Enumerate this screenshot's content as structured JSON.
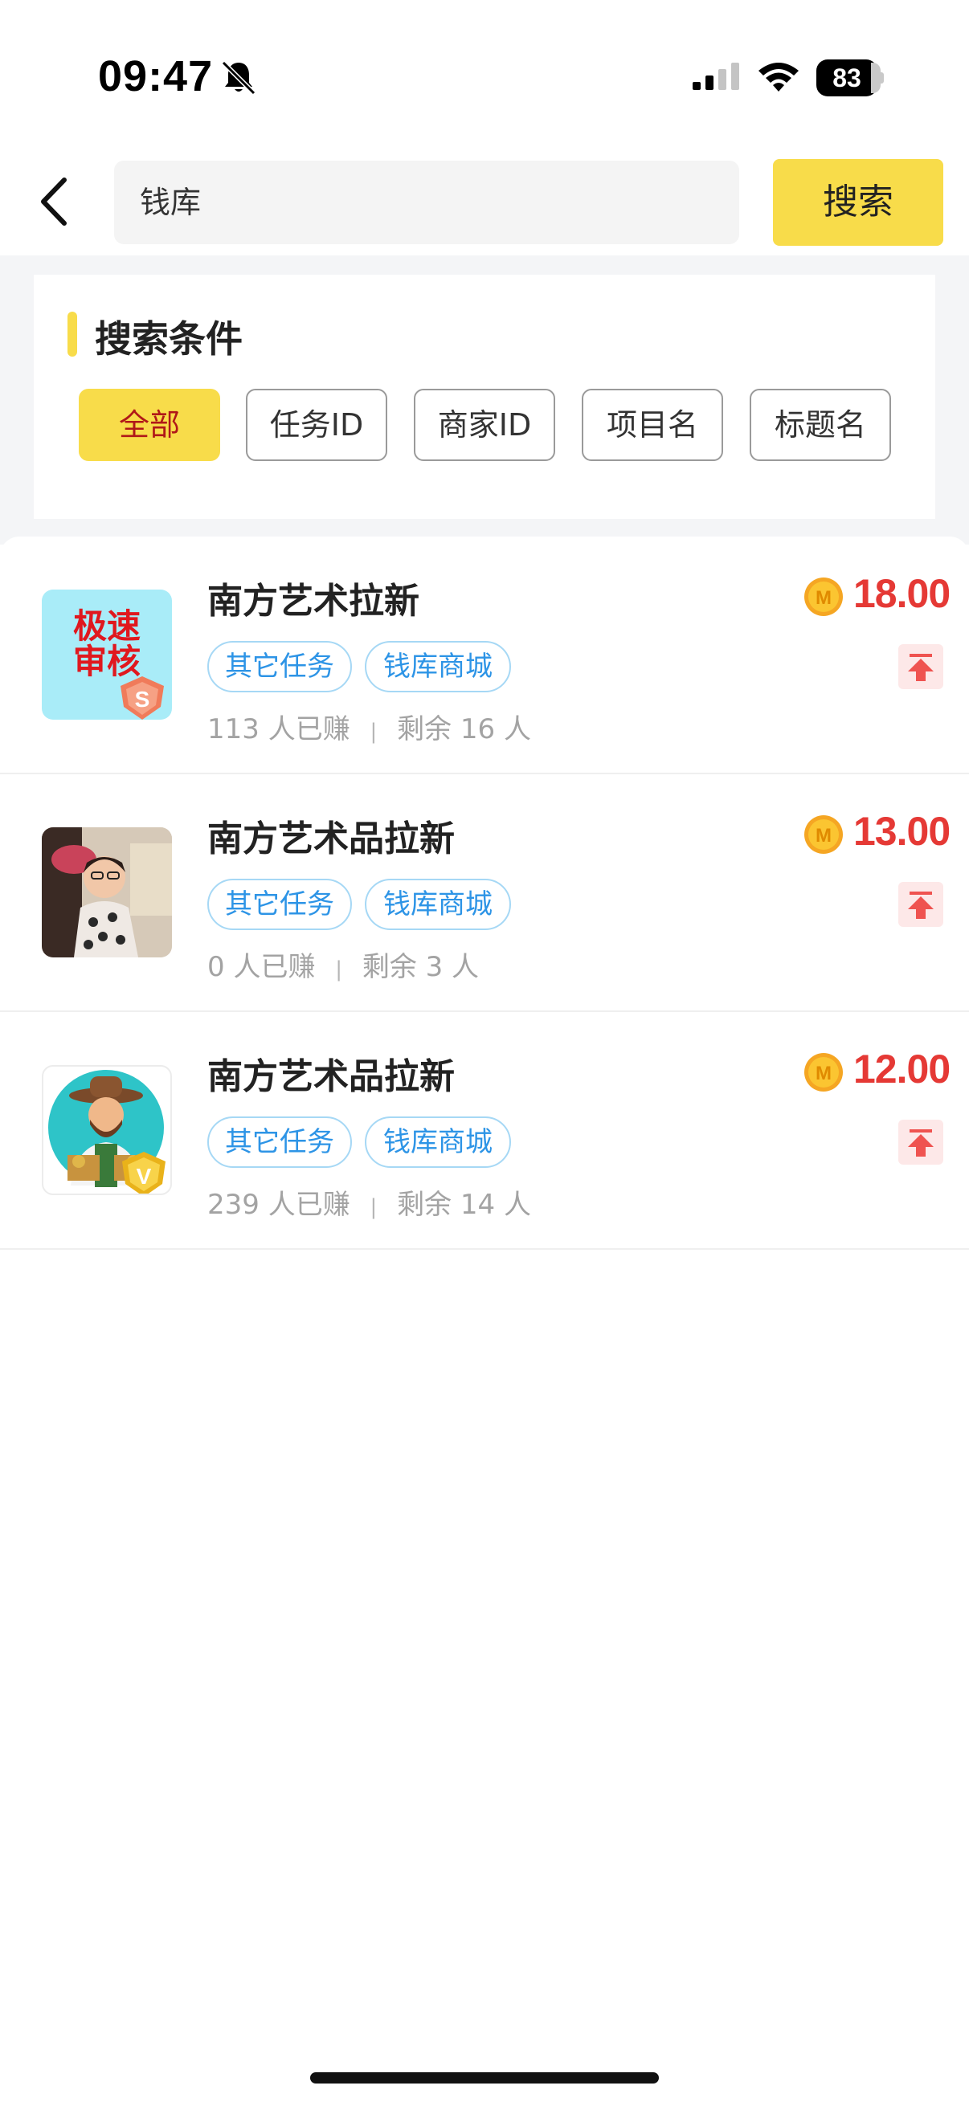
{
  "status_bar": {
    "time": "09:47",
    "battery": "83"
  },
  "search": {
    "value": "钱库",
    "button_label": "搜索"
  },
  "filter": {
    "title": "搜索条件",
    "chips": [
      "全部",
      "任务ID",
      "商家ID",
      "项目名",
      "标题名"
    ],
    "active_index": 0
  },
  "thumb_badges": {
    "first": "极速\n审核",
    "first_badge": "S",
    "third_badge": "V"
  },
  "tasks": [
    {
      "title": "南方艺术拉新",
      "tags": [
        "其它任务",
        "钱库商城"
      ],
      "earned": "113 人已赚",
      "remaining": "剩余 16 人",
      "price": "18.00"
    },
    {
      "title": "南方艺术品拉新",
      "tags": [
        "其它任务",
        "钱库商城"
      ],
      "earned": "0 人已赚",
      "remaining": "剩余 3 人",
      "price": "13.00"
    },
    {
      "title": "南方艺术品拉新",
      "tags": [
        "其它任务",
        "钱库商城"
      ],
      "earned": "239 人已赚",
      "remaining": "剩余 14 人",
      "price": "12.00"
    }
  ],
  "coin_letter": "M",
  "icons": [
    "bell-off-icon",
    "signal-icon",
    "wifi-icon",
    "battery-icon",
    "back-icon",
    "coin-icon",
    "pin-top-icon"
  ],
  "colors": {
    "accent": "#f8dc4a",
    "price": "#e53935",
    "tag": "#2d94e6"
  }
}
